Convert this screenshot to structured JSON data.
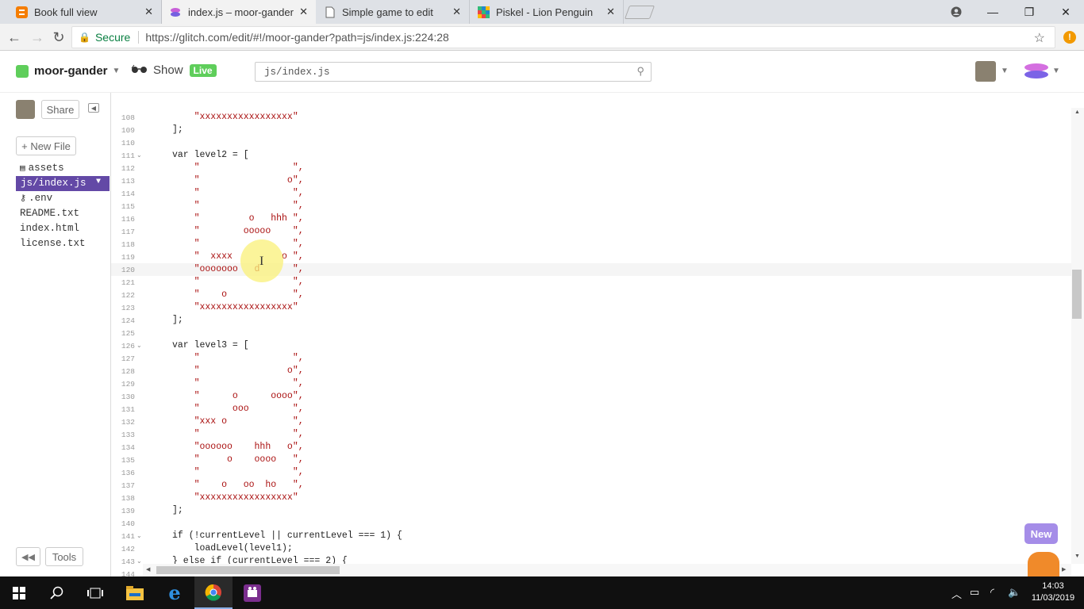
{
  "browser": {
    "tabs": [
      {
        "title": "Book full view",
        "icon": "blogger-icon"
      },
      {
        "title": "index.js – moor-gander",
        "icon": "glitch-icon",
        "active": true
      },
      {
        "title": "Simple game to edit",
        "icon": "document-icon"
      },
      {
        "title": "Piskel - Lion Penguin",
        "icon": "piskel-icon"
      }
    ],
    "secure_label": "Secure",
    "url": "https://glitch.com/edit/#!/moor-gander?path=js/index.js:224:28"
  },
  "glitch": {
    "project_name": "moor-gander",
    "show_label": "Show",
    "live_badge": "Live",
    "search_value": "js/index.js",
    "share_label": "Share",
    "new_file_label": "+ New File",
    "tools_label": "Tools",
    "new_badge": "New",
    "files": [
      {
        "name": "assets",
        "icon": "assets-icon"
      },
      {
        "name": "js/index.js",
        "active": true
      },
      {
        "name": ".env",
        "icon": "key-icon"
      },
      {
        "name": "README.txt"
      },
      {
        "name": "index.html"
      },
      {
        "name": "license.txt"
      }
    ]
  },
  "editor": {
    "lines": [
      {
        "n": "108",
        "text": "    \"xxxxxxxxxxxxxxxxx\""
      },
      {
        "n": "109",
        "text": "];"
      },
      {
        "n": "110",
        "text": ""
      },
      {
        "n": "111",
        "text": "var level2 = [",
        "fold": true
      },
      {
        "n": "112",
        "text": "    \"                 \","
      },
      {
        "n": "113",
        "text": "    \"                o\","
      },
      {
        "n": "114",
        "text": "    \"                 \","
      },
      {
        "n": "115",
        "text": "    \"                 \","
      },
      {
        "n": "116",
        "text": "    \"         o   hhh \","
      },
      {
        "n": "117",
        "text": "    \"        ooooo    \","
      },
      {
        "n": "118",
        "text": "    \"                 \","
      },
      {
        "n": "119",
        "text": "    \"  xxxx         o \","
      },
      {
        "n": "120",
        "text": "    \"ooooooo   d      \","
      },
      {
        "n": "121",
        "text": "    \"                 \","
      },
      {
        "n": "122",
        "text": "    \"    o            \","
      },
      {
        "n": "123",
        "text": "    \"xxxxxxxxxxxxxxxxx\""
      },
      {
        "n": "124",
        "text": "];"
      },
      {
        "n": "125",
        "text": ""
      },
      {
        "n": "126",
        "text": "var level3 = [",
        "fold": true
      },
      {
        "n": "127",
        "text": "    \"                 \","
      },
      {
        "n": "128",
        "text": "    \"                o\","
      },
      {
        "n": "129",
        "text": "    \"                 \","
      },
      {
        "n": "130",
        "text": "    \"      o      oooo\","
      },
      {
        "n": "131",
        "text": "    \"      ooo        \","
      },
      {
        "n": "132",
        "text": "    \"xxx o            \","
      },
      {
        "n": "133",
        "text": "    \"                 \","
      },
      {
        "n": "134",
        "text": "    \"oooooo    hhh   o\","
      },
      {
        "n": "135",
        "text": "    \"     o    oooo   \","
      },
      {
        "n": "136",
        "text": "    \"                 \","
      },
      {
        "n": "137",
        "text": "    \"    o   oo  ho   \","
      },
      {
        "n": "138",
        "text": "    \"xxxxxxxxxxxxxxxxx\""
      },
      {
        "n": "139",
        "text": "];"
      },
      {
        "n": "140",
        "text": ""
      },
      {
        "n": "141",
        "text": "if (!currentLevel || currentLevel === 1) {",
        "fold": true
      },
      {
        "n": "142",
        "text": "    loadLevel(level1);"
      },
      {
        "n": "143",
        "text": "} else if (currentLevel === 2) {",
        "fold": true
      },
      {
        "n": "144",
        "text": ""
      }
    ]
  },
  "taskbar": {
    "time": "14:03",
    "date": "11/03/2019"
  }
}
